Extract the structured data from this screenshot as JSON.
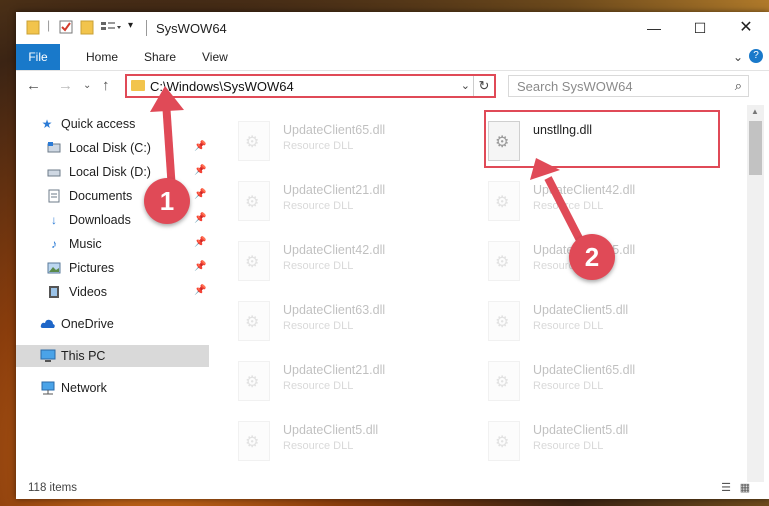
{
  "window": {
    "title": "SysWOW64"
  },
  "ribbon": {
    "file": "File",
    "home": "Home",
    "share": "Share",
    "view": "View"
  },
  "nav": {
    "address": "C:\\Windows\\SysWOW64",
    "search_placeholder": "Search SysWOW64"
  },
  "sidebar": {
    "items": [
      {
        "label": "Quick access"
      },
      {
        "label": "Local Disk (C:)"
      },
      {
        "label": "Local Disk (D:)"
      },
      {
        "label": "Documents"
      },
      {
        "label": "Downloads"
      },
      {
        "label": "Music"
      },
      {
        "label": "Pictures"
      },
      {
        "label": "Videos"
      },
      {
        "label": "OneDrive"
      },
      {
        "label": "This PC"
      },
      {
        "label": "Network"
      }
    ]
  },
  "files": [
    {
      "name": "UpdateClient65.dll",
      "type": "Resource DLL"
    },
    {
      "name": "unstllng.dll",
      "type": ""
    },
    {
      "name": "UpdateClient21.dll",
      "type": "Resource DLL"
    },
    {
      "name": "UpdateClient42.dll",
      "type": "Resource DLL"
    },
    {
      "name": "UpdateClient42.dll",
      "type": "Resource DLL"
    },
    {
      "name": "UpdateClient65.dll",
      "type": "Resource DLL"
    },
    {
      "name": "UpdateClient63.dll",
      "type": "Resource DLL"
    },
    {
      "name": "UpdateClient5.dll",
      "type": "Resource DLL"
    },
    {
      "name": "UpdateClient21.dll",
      "type": "Resource DLL"
    },
    {
      "name": "UpdateClient65.dll",
      "type": "Resource DLL"
    },
    {
      "name": "UpdateClient5.dll",
      "type": "Resource DLL"
    },
    {
      "name": "UpdateClient5.dll",
      "type": "Resource DLL"
    }
  ],
  "status": {
    "items_count": "118 items"
  },
  "annotations": {
    "step1": "1",
    "step2": "2"
  },
  "colors": {
    "accent": "#1979ca",
    "highlight": "#e04a57",
    "folder": "#f2c44c"
  }
}
